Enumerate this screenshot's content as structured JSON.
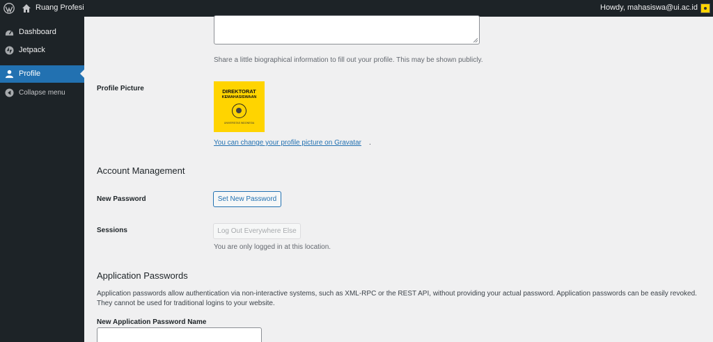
{
  "adminbar": {
    "site_name": "Ruang Profesi",
    "howdy": "Howdy, mahasiswa@ui.ac.id"
  },
  "sidebar": {
    "items": [
      {
        "label": "Dashboard",
        "icon": "dashboard-icon"
      },
      {
        "label": "Jetpack",
        "icon": "jetpack-icon"
      },
      {
        "label": "Profile",
        "icon": "user-icon",
        "current": true
      },
      {
        "label": "Collapse menu",
        "icon": "collapse-icon"
      }
    ]
  },
  "profile": {
    "bio_description": "Share a little biographical information to fill out your profile. This may be shown publicly.",
    "picture_label": "Profile Picture",
    "picture_text_line1": "DIREKTORAT",
    "picture_text_line2": "KEMAHASISWAAN",
    "picture_text_line3": "UNIVERSITAS INDONESIA",
    "gravatar_link": "You can change your profile picture on Gravatar",
    "gravatar_suffix": "."
  },
  "account": {
    "title": "Account Management",
    "new_password_label": "New Password",
    "set_password_button": "Set New Password",
    "sessions_label": "Sessions",
    "logout_button": "Log Out Everywhere Else",
    "sessions_desc": "You are only logged in at this location."
  },
  "app_passwords": {
    "title": "Application Passwords",
    "description": "Application passwords allow authentication via non-interactive systems, such as XML-RPC or the REST API, without providing your actual password. Application passwords can be easily revoked. They cannot be used for traditional logins to your website.",
    "name_label": "New Application Password Name",
    "name_value": ""
  },
  "colors": {
    "admin_bg": "#1d2327",
    "accent": "#2271b1",
    "content_bg": "#f0f0f1",
    "avatar_yellow": "#ffd400"
  }
}
